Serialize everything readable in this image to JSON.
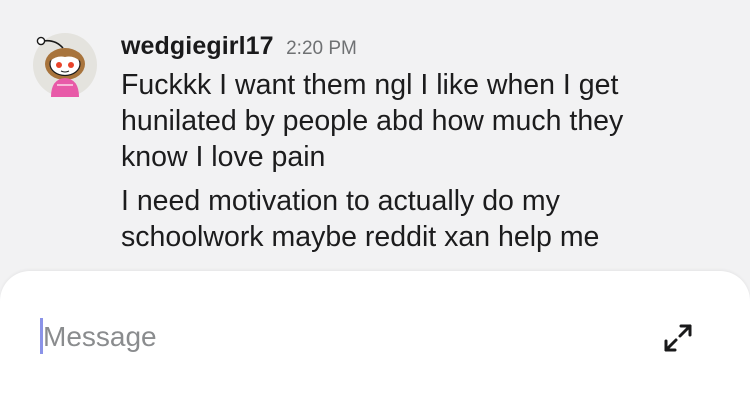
{
  "message": {
    "username": "wedgiegirl17",
    "timestamp": "2:20 PM",
    "avatar": "reddit-snoo-avatar",
    "lines": [
      "Fuckkk I want them ngl I like when I get",
      "hunilated by people abd how much they",
      "know I love pain",
      "I need motivation to actually do my",
      "schoolwork maybe reddit xan help me"
    ]
  },
  "composer": {
    "placeholder": "Message",
    "expand_icon": "expand-icon"
  },
  "colors": {
    "chat_background": "#f2f2f3",
    "composer_background": "#ffffff",
    "caret": "#8b93e8",
    "text": "#1c1c1d",
    "timestamp": "#6f7173"
  }
}
